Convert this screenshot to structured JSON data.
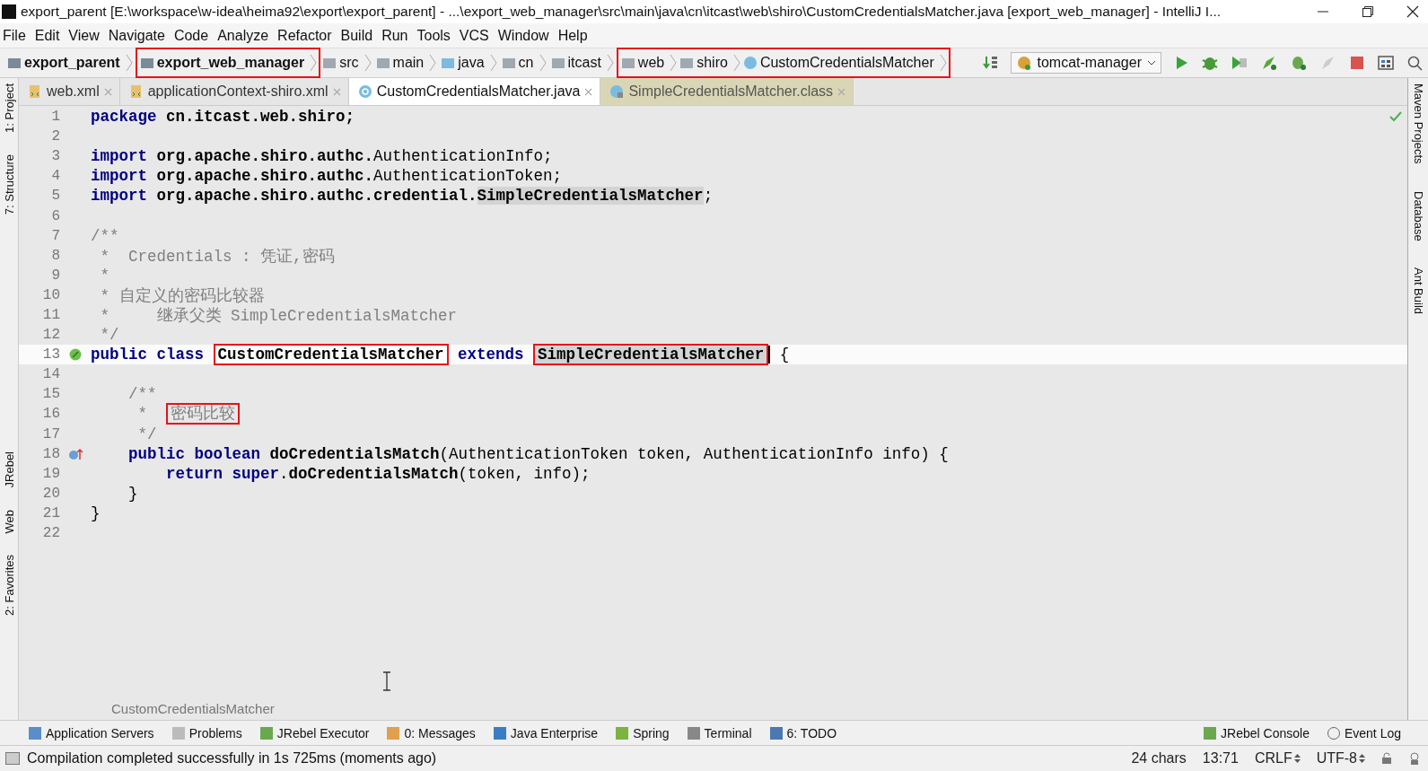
{
  "window": {
    "title": "export_parent [E:\\workspace\\w-idea\\heima92\\export\\export_parent] - ...\\export_web_manager\\src\\main\\java\\cn\\itcast\\web\\shiro\\CustomCredentialsMatcher.java [export_web_manager] - IntelliJ I..."
  },
  "menu": [
    "File",
    "Edit",
    "View",
    "Navigate",
    "Code",
    "Analyze",
    "Refactor",
    "Build",
    "Run",
    "Tools",
    "VCS",
    "Window",
    "Help"
  ],
  "breadcrumbs": [
    {
      "label": "export_parent",
      "kind": "module",
      "annotated": false
    },
    {
      "label": "export_web_manager",
      "kind": "module",
      "annotated": true
    },
    {
      "label": "src",
      "kind": "folder",
      "annotated": false
    },
    {
      "label": "main",
      "kind": "folder",
      "annotated": false
    },
    {
      "label": "java",
      "kind": "source",
      "annotated": false
    },
    {
      "label": "cn",
      "kind": "package",
      "annotated": false
    },
    {
      "label": "itcast",
      "kind": "package",
      "annotated": false
    },
    {
      "label": "web",
      "kind": "package",
      "annotated": true
    },
    {
      "label": "shiro",
      "kind": "package",
      "annotated": true
    },
    {
      "label": "CustomCredentialsMatcher",
      "kind": "class",
      "annotated": true
    }
  ],
  "run_config": "tomcat-manager",
  "tabs": [
    {
      "label": "web.xml",
      "kind": "xml",
      "selected": false
    },
    {
      "label": "applicationContext-shiro.xml",
      "kind": "xml",
      "selected": false
    },
    {
      "label": "CustomCredentialsMatcher.java",
      "kind": "java",
      "selected": true
    },
    {
      "label": "SimpleCredentialsMatcher.class",
      "kind": "class",
      "selected": false
    }
  ],
  "left_strip": [
    "1: Project",
    "7: Structure",
    "JRebel",
    "Web",
    "2: Favorites"
  ],
  "right_strip": [
    "Maven Projects",
    "Database",
    "Ant Build"
  ],
  "code": [
    {
      "number": "1",
      "current": false,
      "tokens": [
        {
          "text": "package",
          "kind": "kw"
        },
        {
          "text": " cn.itcast.web.shiro;",
          "kind": "bold"
        }
      ]
    },
    {
      "number": "2",
      "current": false
    },
    {
      "number": "3",
      "current": false,
      "tokens": [
        {
          "text": "import",
          "kind": "kw"
        },
        {
          "text": " org.apache.shiro.authc.",
          "kind": "bold"
        },
        {
          "text": "AuthenticationInfo",
          "kind": "type"
        },
        {
          "text": ";",
          "kind": "text"
        }
      ]
    },
    {
      "number": "4",
      "current": false,
      "tokens": [
        {
          "text": "import",
          "kind": "kw"
        },
        {
          "text": " org.apache.shiro.authc.",
          "kind": "bold"
        },
        {
          "text": "AuthenticationToken",
          "kind": "type"
        },
        {
          "text": ";",
          "kind": "text"
        }
      ]
    },
    {
      "number": "5",
      "current": false,
      "tokens": [
        {
          "text": "import",
          "kind": "kw"
        },
        {
          "text": " org.apache.shiro.authc.credential.",
          "kind": "bold"
        },
        {
          "text": "SimpleCredentialsMatcher",
          "kind": "usage"
        },
        {
          "text": ";",
          "kind": "text"
        }
      ]
    },
    {
      "number": "6",
      "current": false
    },
    {
      "number": "7",
      "current": false,
      "tokens": [
        {
          "text": "/**",
          "kind": "comment"
        }
      ]
    },
    {
      "number": "8",
      "current": false,
      "tokens": [
        {
          "text": " *  Credentials : 凭证,密码",
          "kind": "comment"
        }
      ]
    },
    {
      "number": "9",
      "current": false,
      "tokens": [
        {
          "text": " *",
          "kind": "comment"
        }
      ]
    },
    {
      "number": "10",
      "current": false,
      "tokens": [
        {
          "text": " * 自定义的密码比较器",
          "kind": "comment"
        }
      ]
    },
    {
      "number": "11",
      "current": false,
      "tokens": [
        {
          "text": " *     继承父类 SimpleCredentialsMatcher",
          "kind": "comment"
        }
      ]
    },
    {
      "number": "12",
      "current": false,
      "tokens": [
        {
          "text": " */",
          "kind": "comment"
        }
      ]
    },
    {
      "number": "13",
      "current": true,
      "kind": "implements",
      "tokens": [
        {
          "text": "public class ",
          "kind": "kw"
        },
        {
          "text": "CustomCredentialsMatcher",
          "kind": "bold",
          "annotated": true
        },
        {
          "text": " extends ",
          "kind": "kw"
        },
        {
          "text": "SimpleCredentialsMatcher",
          "kind": "usage",
          "annotated": true
        },
        {
          "kind": "caret"
        },
        {
          "text": " {",
          "kind": "text"
        }
      ]
    },
    {
      "number": "14",
      "current": false
    },
    {
      "number": "15",
      "current": false,
      "tokens": [
        {
          "text": "    /**",
          "kind": "comment"
        }
      ]
    },
    {
      "number": "16",
      "current": false,
      "tokens": [
        {
          "text": "     *  ",
          "kind": "comment"
        },
        {
          "text": "密码比较",
          "kind": "comment",
          "annotated": true
        }
      ]
    },
    {
      "number": "17",
      "current": false,
      "tokens": [
        {
          "text": "     */",
          "kind": "comment"
        }
      ]
    },
    {
      "number": "18",
      "current": false,
      "kind": "overrides",
      "tokens": [
        {
          "text": "    public boolean ",
          "kind": "kw"
        },
        {
          "text": "doCredentialsMatch",
          "kind": "bold"
        },
        {
          "text": "(AuthenticationToken token, AuthenticationInfo info) {",
          "kind": "type"
        }
      ]
    },
    {
      "number": "19",
      "current": false,
      "tokens": [
        {
          "text": "        return super",
          "kind": "kw"
        },
        {
          "text": ".",
          "kind": "text"
        },
        {
          "text": "doCredentialsMatch",
          "kind": "bold"
        },
        {
          "text": "(token, info);",
          "kind": "type"
        }
      ]
    },
    {
      "number": "20",
      "current": false,
      "tokens": [
        {
          "text": "    }",
          "kind": "text"
        }
      ]
    },
    {
      "number": "21",
      "current": false,
      "tokens": [
        {
          "text": "}",
          "kind": "text"
        }
      ]
    },
    {
      "number": "22",
      "current": false
    }
  ],
  "editor_breadcrumb": "CustomCredentialsMatcher",
  "tool_windows_left": [
    {
      "label": "Application Servers",
      "kind": "servers"
    },
    {
      "label": "Problems",
      "kind": "problems"
    },
    {
      "label": "JRebel Executor",
      "kind": "jrebel"
    },
    {
      "label": "0: Messages",
      "kind": "messages"
    },
    {
      "label": "Java Enterprise",
      "kind": "enterprise"
    },
    {
      "label": "Spring",
      "kind": "spring"
    },
    {
      "label": "Terminal",
      "kind": "terminal"
    },
    {
      "label": "6: TODO",
      "kind": "todo"
    }
  ],
  "tool_windows_right": [
    {
      "label": "JRebel Console",
      "kind": "jrebel"
    },
    {
      "label": "Event Log",
      "kind": "log"
    }
  ],
  "status_bar": {
    "message": "Compilation completed successfully in 1s 725ms (moments ago)",
    "chars": "24 chars",
    "position": "13:71",
    "line_separator": "CRLF",
    "encoding": "UTF-8"
  }
}
